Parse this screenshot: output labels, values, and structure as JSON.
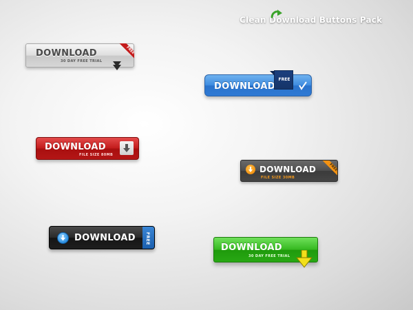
{
  "header": {
    "title": "Clean Download Buttons Pack"
  },
  "colors": {
    "red": "#c21b1b",
    "blue": "#3d8be0",
    "orange": "#f39212",
    "green": "#34b81f",
    "silver": "#dedede",
    "dark": "#2a2a2a"
  },
  "buttons": [
    {
      "label": "DOWNLOAD",
      "sub": "30 DAY FREE TRIAL",
      "badge": "FREE",
      "icon": "arrow-down-icon"
    },
    {
      "label": "DOWNLOAD",
      "badge": "FREE",
      "icon": "checkmark-icon"
    },
    {
      "label": "DOWNLOAD",
      "sub": "FILE SIZE 80MB",
      "icon": "download-box-icon"
    },
    {
      "label": "DOWNLOAD",
      "sub": "FILE SIZE 30MB",
      "badge": "FREE",
      "icon": "download-circle-icon"
    },
    {
      "label": "DOWNLOAD",
      "badge": "FREE",
      "icon": "download-circle-icon"
    },
    {
      "label": "DOWNLOAD",
      "sub": "30 DAY FREE TRIAL",
      "icon": "arrow-down-icon"
    }
  ]
}
